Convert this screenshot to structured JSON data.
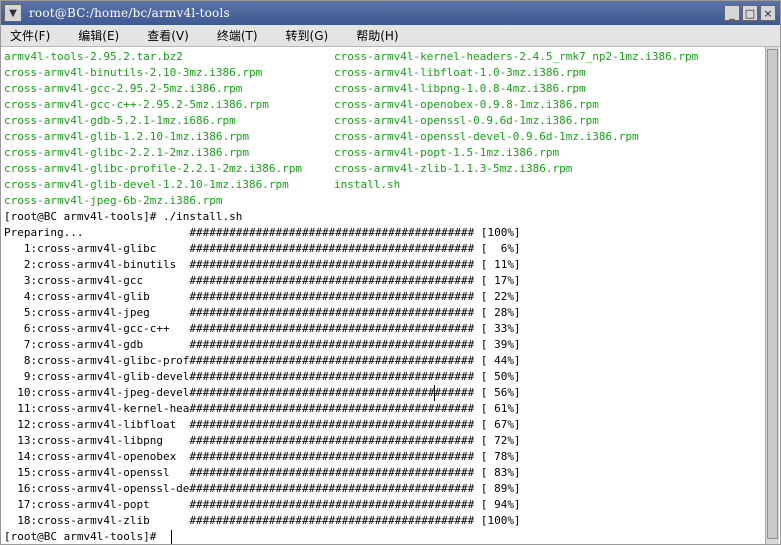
{
  "window": {
    "title": "root@BC:/home/bc/armv4l-tools",
    "menu_icon": "terminal-menu-icon",
    "buttons": {
      "minimize": "_",
      "maximize": "□",
      "close": "×"
    }
  },
  "menu": {
    "file": "文件(F)",
    "edit": "编辑(E)",
    "view": "查看(V)",
    "terminal": "终端(T)",
    "goto": "转到(G)",
    "help": "帮助(H)"
  },
  "listing": {
    "left": [
      "armv4l-tools-2.95.2.tar.bz2",
      "cross-armv4l-binutils-2.10-3mz.i386.rpm",
      "cross-armv4l-gcc-2.95.2-5mz.i386.rpm",
      "cross-armv4l-gcc-c++-2.95.2-5mz.i386.rpm",
      "cross-armv4l-gdb-5.2.1-1mz.i686.rpm",
      "cross-armv4l-glib-1.2.10-1mz.i386.rpm",
      "cross-armv4l-glibc-2.2.1-2mz.i386.rpm",
      "cross-armv4l-glibc-profile-2.2.1-2mz.i386.rpm",
      "cross-armv4l-glib-devel-1.2.10-1mz.i386.rpm",
      "cross-armv4l-jpeg-6b-2mz.i386.rpm"
    ],
    "right": [
      "cross-armv4l-kernel-headers-2.4.5_rmk7_np2-1mz.i386.rpm",
      "cross-armv4l-libfloat-1.0-3mz.i386.rpm",
      "cross-armv4l-libpng-1.0.8-4mz.i386.rpm",
      "cross-armv4l-openobex-0.9.8-1mz.i386.rpm",
      "cross-armv4l-openssl-0.9.6d-1mz.i386.rpm",
      "cross-armv4l-openssl-devel-0.9.6d-1mz.i386.rpm",
      "cross-armv4l-popt-1.5-1mz.i386.rpm",
      "cross-armv4l-zlib-1.1.3-5mz.i386.rpm",
      "install.sh"
    ]
  },
  "commands": {
    "install": "[root@BC armv4l-tools]# ./install.sh",
    "prompt": "[root@BC armv4l-tools]# "
  },
  "install_output": [
    "Preparing...                ########################################### [100%]",
    "   1:cross-armv4l-glibc     ########################################### [  6%]",
    "   2:cross-armv4l-binutils  ########################################### [ 11%]",
    "   3:cross-armv4l-gcc       ########################################### [ 17%]",
    "   4:cross-armv4l-glib      ########################################### [ 22%]",
    "   5:cross-armv4l-jpeg      ########################################### [ 28%]",
    "   6:cross-armv4l-gcc-c++   ########################################### [ 33%]",
    "   7:cross-armv4l-gdb       ########################################### [ 39%]",
    "   8:cross-armv4l-glibc-prof########################################### [ 44%]",
    "   9:cross-armv4l-glib-devel########################################### [ 50%]",
    "  10:cross-armv4l-jpeg-devel########################################### [ 56%]",
    "  11:cross-armv4l-kernel-hea########################################### [ 61%]",
    "  12:cross-armv4l-libfloat  ########################################### [ 67%]",
    "  13:cross-armv4l-libpng    ########################################### [ 72%]",
    "  14:cross-armv4l-openobex  ########################################### [ 78%]",
    "  15:cross-armv4l-openssl   ########################################### [ 83%]",
    "  16:cross-armv4l-openssl-de########################################### [ 89%]",
    "  17:cross-armv4l-popt      ########################################### [ 94%]",
    "  18:cross-armv4l-zlib      ########################################### [100%]"
  ],
  "colors": {
    "file_green": "#1aa01a",
    "titlebar": "#4a6299",
    "menubar": "#e4e4e4"
  }
}
